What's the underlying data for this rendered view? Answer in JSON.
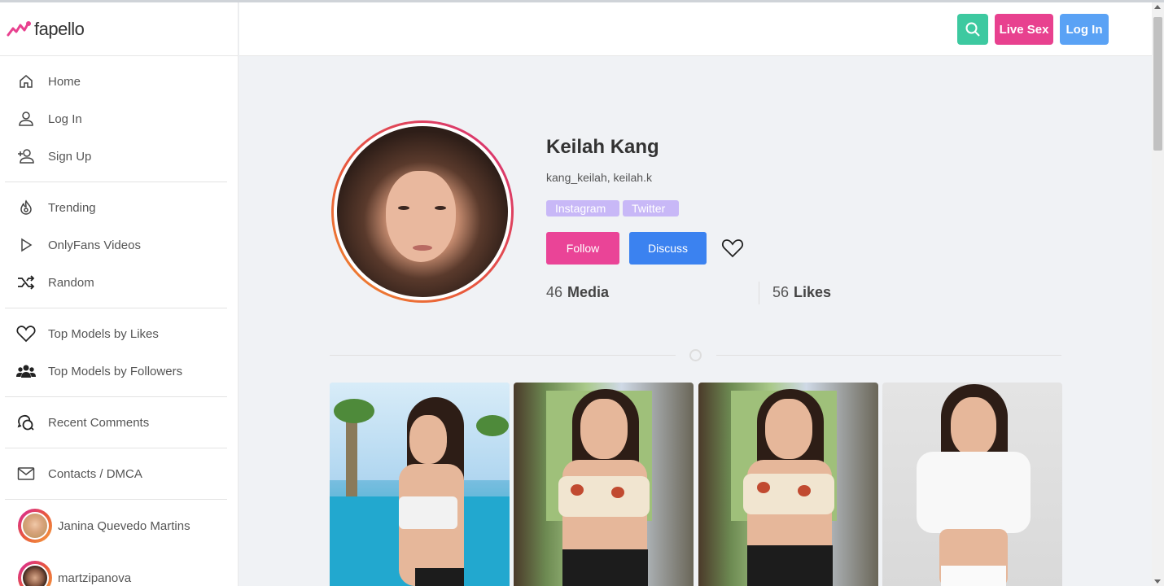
{
  "site": {
    "logo_text": "fapello",
    "brand_color": "#e8418f"
  },
  "header": {
    "search_icon": "search-icon",
    "live_sex_label": "Live Sex",
    "login_label": "Log In"
  },
  "sidebar": {
    "groups": [
      [
        {
          "icon": "home-icon",
          "label": "Home"
        },
        {
          "icon": "user-icon",
          "label": "Log In"
        },
        {
          "icon": "user-add-icon",
          "label": "Sign Up"
        }
      ],
      [
        {
          "icon": "fire-icon",
          "label": "Trending"
        },
        {
          "icon": "play-icon",
          "label": "OnlyFans Videos"
        },
        {
          "icon": "shuffle-icon",
          "label": "Random"
        }
      ],
      [
        {
          "icon": "heart-icon",
          "label": "Top Models by Likes"
        },
        {
          "icon": "users-icon",
          "label": "Top Models by Followers"
        }
      ],
      [
        {
          "icon": "comments-icon",
          "label": "Recent Comments"
        }
      ],
      [
        {
          "icon": "mail-icon",
          "label": "Contacts / DMCA"
        }
      ]
    ],
    "models": [
      {
        "name": "Janina Quevedo Martins"
      },
      {
        "name": "martzipanova"
      }
    ]
  },
  "profile": {
    "name": "Keilah Kang",
    "aliases": "kang_keilah, keilah.k",
    "tags": [
      "Instagram",
      "Twitter"
    ],
    "follow_label": "Follow",
    "discuss_label": "Discuss",
    "media_count": "46",
    "media_label": "Media",
    "likes_count": "56",
    "likes_label": "Likes"
  }
}
